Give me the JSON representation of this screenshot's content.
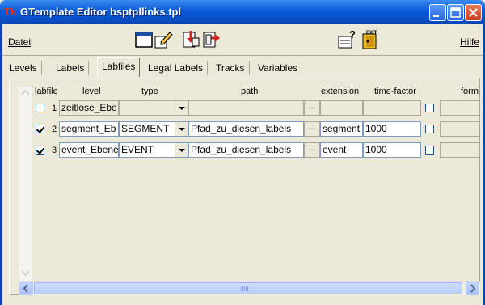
{
  "window": {
    "title": "GTemplate Editor bsptpllinks.tpl",
    "app_icon": "Tk"
  },
  "menu": {
    "file": "Datei",
    "help": "Hilfe"
  },
  "toolbar": {
    "icons": [
      "window-icon",
      "edit-icon",
      "import-icon",
      "export-icon",
      "help-icon",
      "exit-icon"
    ],
    "exit_label": "EXIT"
  },
  "tabs": [
    "Levels",
    "Labels",
    "Labfiles",
    "Legal Labels",
    "Tracks",
    "Variables"
  ],
  "active_tab": "Labfiles",
  "table": {
    "headers": {
      "labfile": "labfile",
      "level": "level",
      "type": "type",
      "path": "path",
      "extension": "extension",
      "time_factor": "time-factor",
      "format": "form"
    },
    "rows": [
      {
        "checked": false,
        "num": "1",
        "level": "zeitlose_Ebe",
        "type": "",
        "path": "",
        "extension": "",
        "time_factor": "",
        "disabled": true
      },
      {
        "checked": true,
        "num": "2",
        "level": "segment_Eb",
        "type": "SEGMENT",
        "path": "Pfad_zu_diesen_labels",
        "extension": "segment",
        "time_factor": "1000",
        "disabled": false
      },
      {
        "checked": true,
        "num": "3",
        "level": "event_Ebene",
        "type": "EVENT",
        "path": "Pfad_zu_diesen_labels",
        "extension": "event",
        "time_factor": "1000",
        "disabled": false
      }
    ],
    "browse_label": "..."
  }
}
